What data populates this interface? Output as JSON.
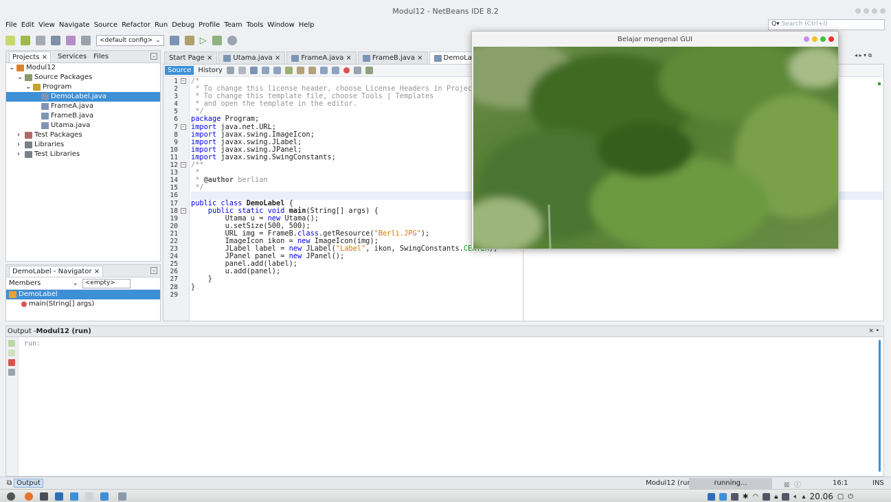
{
  "window": {
    "title": "Modul12 - NetBeans IDE 8.2"
  },
  "menu": [
    "File",
    "Edit",
    "View",
    "Navigate",
    "Source",
    "Refactor",
    "Run",
    "Debug",
    "Profile",
    "Team",
    "Tools",
    "Window",
    "Help"
  ],
  "search": {
    "placeholder": "Search (Ctrl+I)"
  },
  "toolbar": {
    "config": "<default config>"
  },
  "projects_panel": {
    "tabs": [
      "Projects ×",
      "Services",
      "Files"
    ],
    "tree": [
      {
        "label": "Modul12",
        "indent": 0,
        "icon": "project-icon"
      },
      {
        "label": "Source Packages",
        "indent": 1,
        "icon": "package-folder-icon"
      },
      {
        "label": "Program",
        "indent": 2,
        "icon": "package-icon"
      },
      {
        "label": "DemoLabel.java",
        "indent": 3,
        "icon": "java-file-icon",
        "selected": true
      },
      {
        "label": "FrameA.java",
        "indent": 3,
        "icon": "java-file-icon"
      },
      {
        "label": "FrameB.java",
        "indent": 3,
        "icon": "java-file-icon"
      },
      {
        "label": "Utama.java",
        "indent": 3,
        "icon": "java-file-icon"
      },
      {
        "label": "Test Packages",
        "indent": 1,
        "icon": "test-folder-icon"
      },
      {
        "label": "Libraries",
        "indent": 1,
        "icon": "library-icon"
      },
      {
        "label": "Test Libraries",
        "indent": 1,
        "icon": "library-icon"
      }
    ]
  },
  "navigator": {
    "title": "DemoLabel - Navigator ×",
    "members_label": "Members",
    "filter_value": "<empty>",
    "items": [
      {
        "label": "DemoLabel",
        "selected": true
      },
      {
        "label": "main(String[] args)"
      }
    ]
  },
  "editor": {
    "tabs": [
      "Start Page ×",
      "Utama.java ×",
      "FrameA.java ×",
      "FrameB.java ×",
      "DemoLabel.java ×"
    ],
    "active_tab": 4,
    "mode_tabs": [
      "Source",
      "History"
    ],
    "line_numbers": [
      "1",
      "2",
      "3",
      "4",
      "5",
      "6",
      "7",
      "8",
      "9",
      "10",
      "11",
      "12",
      "13",
      "14",
      "15",
      "16",
      "17",
      "18",
      "19",
      "20",
      "21",
      "22",
      "23",
      "24",
      "25",
      "26",
      "27",
      "28",
      "29"
    ],
    "code": {
      "l1": "/*",
      "l2": " * To change this license header, choose License Headers in Project Properties.",
      "l3": " * To change this template file, choose Tools | Templates",
      "l4": " * and open the template in the editor.",
      "l5": " */",
      "l6a": "package",
      "l6b": " Program;",
      "l7a": "import",
      "l7b": " java.net.URL;",
      "l8a": "import",
      "l8b": " javax.swing.ImageIcon;",
      "l9a": "import",
      "l9b": " javax.swing.JLabel;",
      "l10a": "import",
      "l10b": " javax.swing.JPanel;",
      "l11a": "import",
      "l11b": " javax.swing.SwingConstants;",
      "l12": "/**",
      "l13": " *",
      "l14a": " * ",
      "l14b": "@author",
      "l14c": " berlian",
      "l15": " */",
      "l17a": "public class",
      "l17b": " DemoLabel",
      "l17c": " {",
      "l18a": "    public static void",
      "l18b": " main",
      "l18c": "(String[] args) {",
      "l19a": "        Utama u = ",
      "l19b": "new",
      "l19c": " Utama();",
      "l20": "        u.setSize(500, 500);",
      "l21a": "        URL img = FrameB.",
      "l21b": "class",
      "l21c": ".getResource(",
      "l21d": "\"Berli.JPG\"",
      "l21e": ");",
      "l22a": "        ImageIcon ikon = ",
      "l22b": "new",
      "l22c": " ImageIcon(img);",
      "l23a": "        JLabel label = ",
      "l23b": "new",
      "l23c": " JLabel(",
      "l23d": "\"Label\"",
      "l23e": ", ikon, SwingConstants.",
      "l23f": "CENTER",
      "l23g": ");",
      "l24a": "        JPanel panel = ",
      "l24b": "new",
      "l24c": " JPanel();",
      "l25": "        panel.add(label);",
      "l26": "        u.add(panel);",
      "l27": "    }",
      "l28": "}"
    }
  },
  "gui_window": {
    "title": "Belajar mengenal GUI"
  },
  "output": {
    "title_prefix": "Output - ",
    "title_bold": "Modul12 (run)",
    "text": "run:"
  },
  "statusbar": {
    "output_button": "Output",
    "project": "Modul12 (run)",
    "progress_label": "running...",
    "position": "16:1",
    "mode": "INS"
  },
  "taskbar": {
    "clock": "20.06"
  },
  "colors": {
    "selection": "#3d8fd6",
    "keyword": "#0000e6",
    "string": "#ce7b00",
    "comment": "#969696"
  }
}
